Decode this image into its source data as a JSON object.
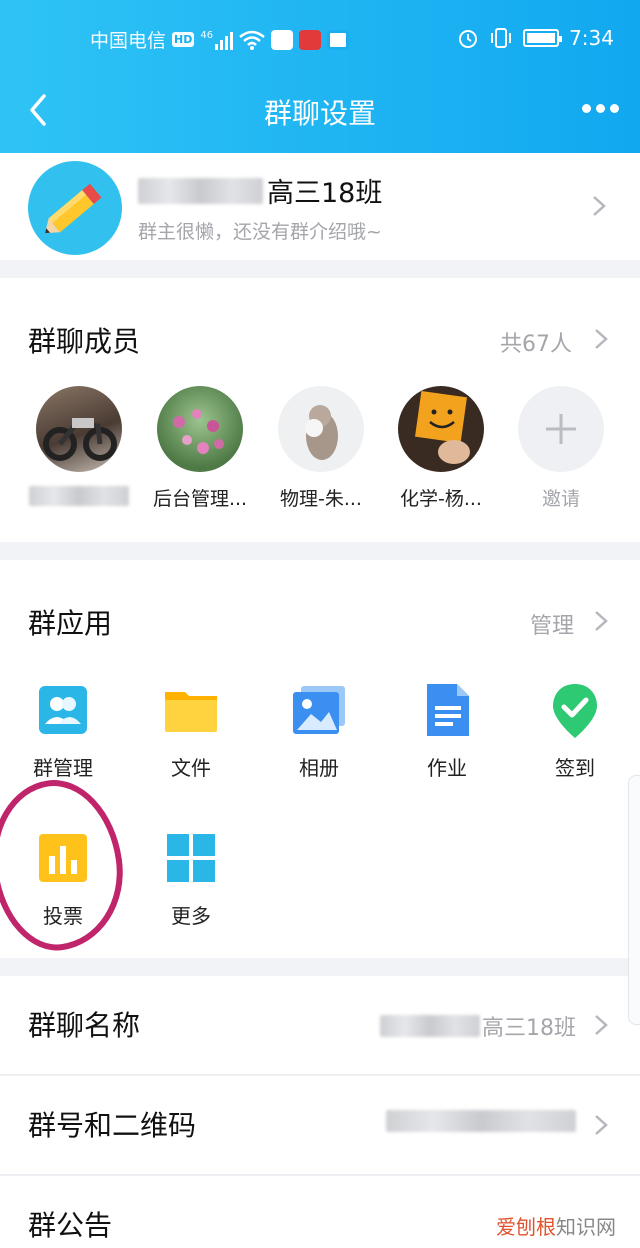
{
  "status_bar": {
    "carrier": "中国电信",
    "hd": "HD",
    "net": "46",
    "time": "7:34"
  },
  "nav": {
    "title": "群聊设置"
  },
  "group": {
    "name": "高三18班",
    "description": "群主很懒，还没有群介绍哦~"
  },
  "members": {
    "title": "群聊成员",
    "count_label": "共67人",
    "list": [
      {
        "name": "",
        "avatar": "motorcycle-photo"
      },
      {
        "name": "后台管理...",
        "avatar": "flowers-photo"
      },
      {
        "name": "物理-朱...",
        "avatar": "snow-monkey-photo"
      },
      {
        "name": "化学-杨...",
        "avatar": "smiley-note-photo"
      }
    ],
    "invite_label": "邀请"
  },
  "apps": {
    "title": "群应用",
    "manage_label": "管理",
    "items": [
      {
        "label": "群管理",
        "icon": "group-manage-icon",
        "color": "#2bb6e8"
      },
      {
        "label": "文件",
        "icon": "folder-icon",
        "color": "#ffc21a"
      },
      {
        "label": "相册",
        "icon": "album-icon",
        "color": "#3a8ff0"
      },
      {
        "label": "作业",
        "icon": "homework-icon",
        "color": "#3a8ff0"
      },
      {
        "label": "签到",
        "icon": "checkin-icon",
        "color": "#2ec973"
      },
      {
        "label": "投票",
        "icon": "vote-icon",
        "color": "#ffc21a"
      },
      {
        "label": "更多",
        "icon": "more-grid-icon",
        "color": "#2bb6e8"
      }
    ]
  },
  "rows": {
    "group_name_label": "群聊名称",
    "group_name_value": "高三18班",
    "qr_label": "群号和二维码",
    "notice_label": "群公告"
  },
  "watermark": {
    "brand": "爱刨根",
    "suffix": "知识网"
  }
}
